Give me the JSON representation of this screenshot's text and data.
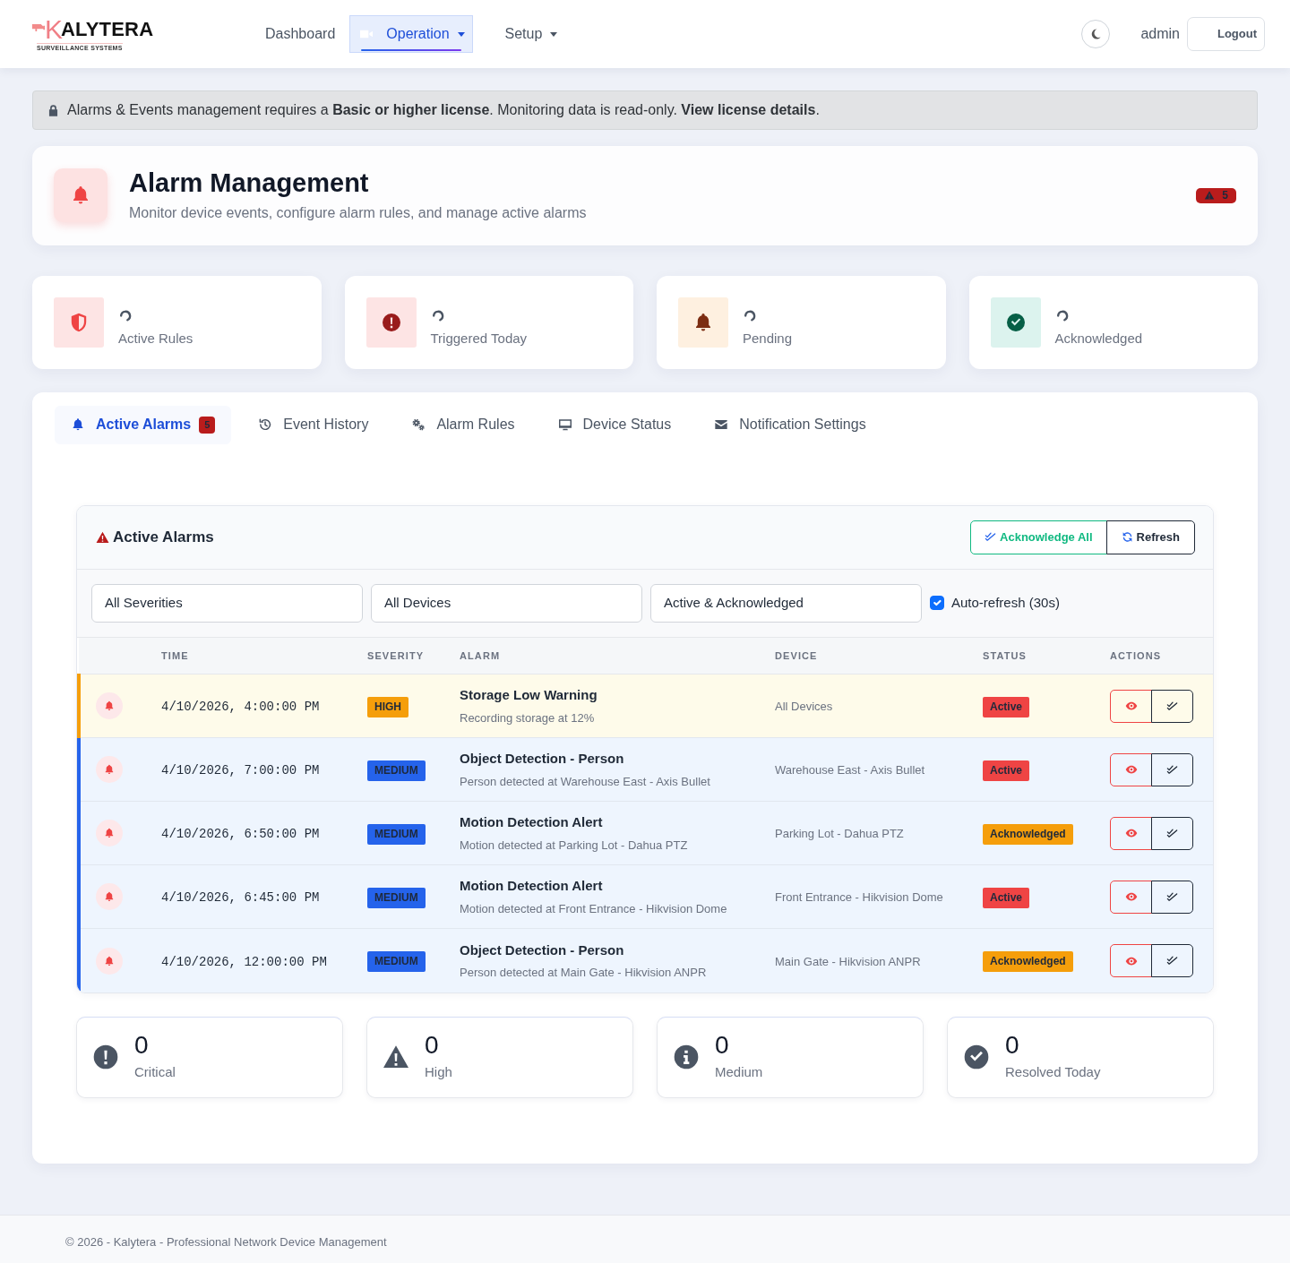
{
  "navbar": {
    "brand": {
      "initial": "K",
      "name": "ALYTERA",
      "tagline": "SURVEILLANCE SYSTEMS"
    },
    "links": [
      {
        "kind": "dashboard",
        "label": "Dashboard",
        "selected": false,
        "dropdown": false
      },
      {
        "kind": "operation",
        "label": "Operation",
        "selected": true,
        "dropdown": true
      },
      {
        "kind": "setup",
        "label": "Setup",
        "selected": false,
        "dropdown": true
      }
    ],
    "user": "admin",
    "logout": "Logout"
  },
  "license_notice": "Alarms & Events management requires a **Basic or higher license**. Monitoring data is read-only. **View license details**.",
  "header": {
    "title": "Alarm Management",
    "subtitle": "Monitor device events, configure alarm rules, and manage active alarms",
    "alarm_count": "5"
  },
  "stats": [
    {
      "kind": "rules",
      "label": "Active Rules"
    },
    {
      "kind": "triggered",
      "label": "Triggered Today"
    },
    {
      "kind": "pending",
      "label": "Pending"
    },
    {
      "kind": "acknowledged",
      "label": "Acknowledged"
    }
  ],
  "tabs": [
    {
      "kind": "alarms",
      "label": "Active Alarms",
      "selected": true,
      "count": "5"
    },
    {
      "kind": "history",
      "label": "Event History",
      "selected": false
    },
    {
      "kind": "rules",
      "label": "Alarm Rules",
      "selected": false
    },
    {
      "kind": "devices",
      "label": "Device Status",
      "selected": false
    },
    {
      "kind": "notifications",
      "label": "Notification Settings",
      "selected": false
    }
  ],
  "alarms_panel": {
    "title": "Active Alarms",
    "acknowledge_all": "Acknowledge All",
    "refresh": "Refresh",
    "filters": [
      {
        "value": "All Severities"
      },
      {
        "value": "All Devices"
      },
      {
        "value": "Active & Acknowledged"
      }
    ],
    "auto_refresh": {
      "label": "Auto-refresh (30s)",
      "checked": true
    },
    "table": {
      "columns": [
        "TIME",
        "SEVERITY",
        "ALARM",
        "DEVICE",
        "STATUS",
        "ACTIONS"
      ],
      "rows": [
        {
          "kind": "high",
          "time": "4/10/2026, 4:00:00 PM",
          "severity": "HIGH",
          "title": "Storage Low Warning",
          "description": "Recording storage at 12%",
          "device": "All Devices",
          "status": {
            "kind": "active",
            "label": "Active"
          }
        },
        {
          "kind": "medium",
          "time": "4/10/2026, 7:00:00 PM",
          "severity": "MEDIUM",
          "title": "Object Detection - Person",
          "description": "Person detected at Warehouse East - Axis Bullet",
          "device": "Warehouse East - Axis Bullet",
          "status": {
            "kind": "active",
            "label": "Active"
          }
        },
        {
          "kind": "medium",
          "time": "4/10/2026, 6:50:00 PM",
          "severity": "MEDIUM",
          "title": "Motion Detection Alert",
          "description": "Motion detected at Parking Lot - Dahua PTZ",
          "device": "Parking Lot - Dahua PTZ",
          "status": {
            "kind": "acknowledged",
            "label": "Acknowledged"
          }
        },
        {
          "kind": "medium",
          "time": "4/10/2026, 6:45:00 PM",
          "severity": "MEDIUM",
          "title": "Motion Detection Alert",
          "description": "Motion detected at Front Entrance - Hikvision Dome",
          "device": "Front Entrance - Hikvision Dome",
          "status": {
            "kind": "active",
            "label": "Active"
          }
        },
        {
          "kind": "medium",
          "time": "4/10/2026, 12:00:00 PM",
          "severity": "MEDIUM",
          "title": "Object Detection - Person",
          "description": "Person detected at Main Gate - Hikvision ANPR",
          "device": "Main Gate - Hikvision ANPR",
          "status": {
            "kind": "acknowledged",
            "label": "Acknowledged"
          }
        }
      ]
    }
  },
  "summary": [
    {
      "kind": "critical",
      "value": "0",
      "label": "Critical"
    },
    {
      "kind": "high",
      "value": "0",
      "label": "High"
    },
    {
      "kind": "medium",
      "value": "0",
      "label": "Medium"
    },
    {
      "kind": "resolved",
      "value": "0",
      "label": "Resolved Today"
    }
  ],
  "footer": "© 2026 - Kalytera - Professional Network Device Management"
}
